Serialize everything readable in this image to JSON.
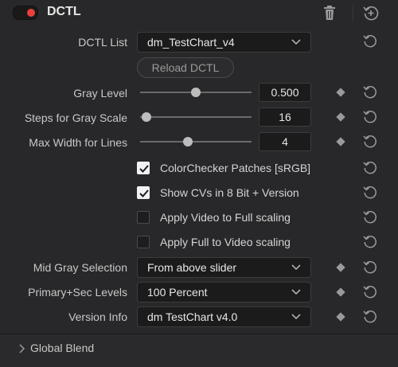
{
  "header": {
    "title": "DCTL",
    "enabled": true,
    "toggle_color": "#e8413b"
  },
  "dctl_list": {
    "label": "DCTL List",
    "value": "dm_TestChart_v4",
    "reload_label": "Reload DCTL"
  },
  "sliders": [
    {
      "label": "Gray Level",
      "value": "0.500",
      "position": 0.5
    },
    {
      "label": "Steps for Gray Scale",
      "value": "16",
      "position": 0.06
    },
    {
      "label": "Max Width for Lines",
      "value": "4",
      "position": 0.43
    }
  ],
  "checkboxes": [
    {
      "label": "ColorChecker Patches [sRGB]",
      "checked": true
    },
    {
      "label": "Show CVs in 8 Bit + Version",
      "checked": true
    },
    {
      "label": "Apply Video to Full scaling",
      "checked": false
    },
    {
      "label": "Apply Full to Video scaling",
      "checked": false
    }
  ],
  "dropdowns": [
    {
      "label": "Mid Gray Selection",
      "value": "From above slider"
    },
    {
      "label": "Primary+Sec Levels",
      "value": "100 Percent"
    },
    {
      "label": "Version Info",
      "value": "dm TestChart v4.0"
    }
  ],
  "footer": {
    "label": "Global Blend"
  },
  "icons": {
    "header": [
      "toggle-switch",
      "trash-icon",
      "reset-icon"
    ],
    "row": [
      "keyframe-diamond-icon",
      "reset-icon"
    ],
    "dropdown": "chevron-down-icon",
    "footer": "chevron-right-icon"
  }
}
